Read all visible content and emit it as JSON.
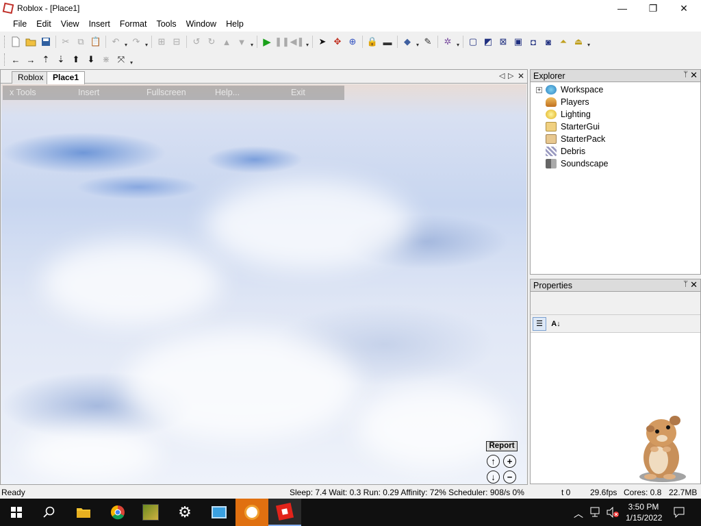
{
  "window": {
    "title": "Roblox - [Place1]",
    "minimize": "—",
    "maximize": "❐",
    "close": "✕"
  },
  "menu": [
    "File",
    "Edit",
    "View",
    "Insert",
    "Format",
    "Tools",
    "Window",
    "Help"
  ],
  "tabs": {
    "items": [
      "Roblox",
      "Place1"
    ],
    "prev": "◁",
    "next": "▷",
    "close": "✕"
  },
  "game_menu": [
    "x Tools",
    "Insert",
    "Fullscreen",
    "Help...",
    "Exit"
  ],
  "viewport": {
    "report": "Report",
    "zoom_in": "+",
    "zoom_out": "−",
    "tilt_up": "↑",
    "tilt_down": "↓"
  },
  "explorer": {
    "title": "Explorer",
    "pin": "ᛘ",
    "close": "✕",
    "expander": "+",
    "items": [
      {
        "label": "Workspace",
        "icon": "globe-icon",
        "color": "#4aa0d8"
      },
      {
        "label": "Players",
        "icon": "players-icon",
        "color": "#e0a040"
      },
      {
        "label": "Lighting",
        "icon": "lightbulb-icon",
        "color": "#f0d040"
      },
      {
        "label": "StarterGui",
        "icon": "folder-icon",
        "color": "#e8c060"
      },
      {
        "label": "StarterPack",
        "icon": "backpack-icon",
        "color": "#d8b070"
      },
      {
        "label": "Debris",
        "icon": "debris-icon",
        "color": "#8888aa"
      },
      {
        "label": "Soundscape",
        "icon": "speaker-icon",
        "color": "#777777"
      }
    ]
  },
  "properties": {
    "title": "Properties",
    "pin": "ᛘ",
    "close": "✕",
    "sort_category": "☰",
    "sort_alpha": "A↓"
  },
  "status": {
    "ready": "Ready",
    "stats": "Sleep: 7.4 Wait: 0.3 Run: 0.29 Affinity: 72% Scheduler: 908/s 0%",
    "t": "t 0",
    "fps": "29.6fps",
    "cores": "Cores: 0.8",
    "mem": "22.7MB"
  },
  "taskbar": {
    "start": "⊞",
    "search": "⚲",
    "time": "3:50 PM",
    "date": "1/15/2022",
    "tray_chevron": "︿",
    "notification": "▭"
  },
  "colors": {
    "accent": "#0078d7",
    "roblox_red": "#e2231a",
    "run_green": "#1aa01a"
  }
}
